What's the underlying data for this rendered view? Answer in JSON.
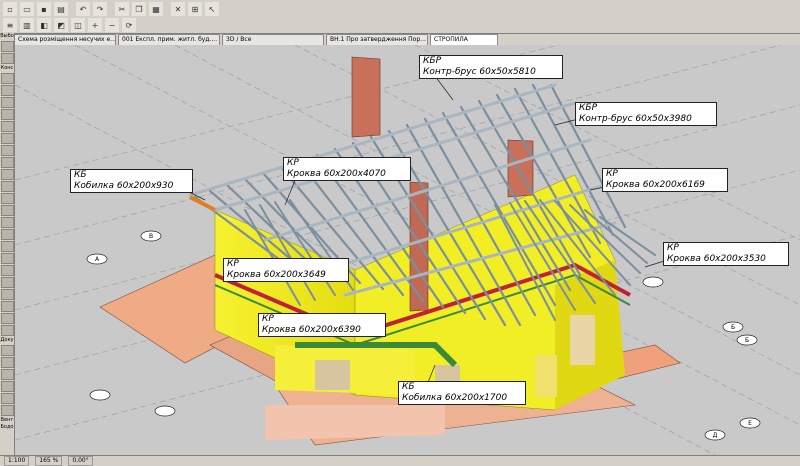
{
  "app": {
    "window_title": "СТРОПИЛА"
  },
  "tabs": [
    {
      "label": "Схема розміщення несучих е..."
    },
    {
      "label": "001 Експл. прим. житл. буд...."
    },
    {
      "label": "3D / Все"
    },
    {
      "label": "ВН.1 Про затвердження Пор..."
    },
    {
      "label": "СТРОПИЛА"
    }
  ],
  "toolbox": {
    "labels": [
      "Выбо",
      "Конс",
      "Доку",
      "Вент",
      "Бодо"
    ]
  },
  "status_bar": {
    "scale": "1:100",
    "zoom": "165 %",
    "angle": "0,00°"
  },
  "grid_axes": [
    "А",
    "В",
    "Б",
    "Б",
    "Е",
    "Д"
  ],
  "callouts": [
    {
      "code": "КБР",
      "text": "Контр-брус 60х50х5810"
    },
    {
      "code": "КБР",
      "text": "Контр-брус 60х50х3980"
    },
    {
      "code": "КР",
      "text": "Кроква 60х200х4070"
    },
    {
      "code": "КБ",
      "text": "Кобилка 60х200х930"
    },
    {
      "code": "КР",
      "text": "Кроква 60х200х6169"
    },
    {
      "code": "КР",
      "text": "Кроква 60х200х3530"
    },
    {
      "code": "КР",
      "text": "Кроква 60х200х3649"
    },
    {
      "code": "КР",
      "text": "Кроква 60х200х6390"
    },
    {
      "code": "КБ",
      "text": "Кобилка 60х200х1700"
    }
  ]
}
